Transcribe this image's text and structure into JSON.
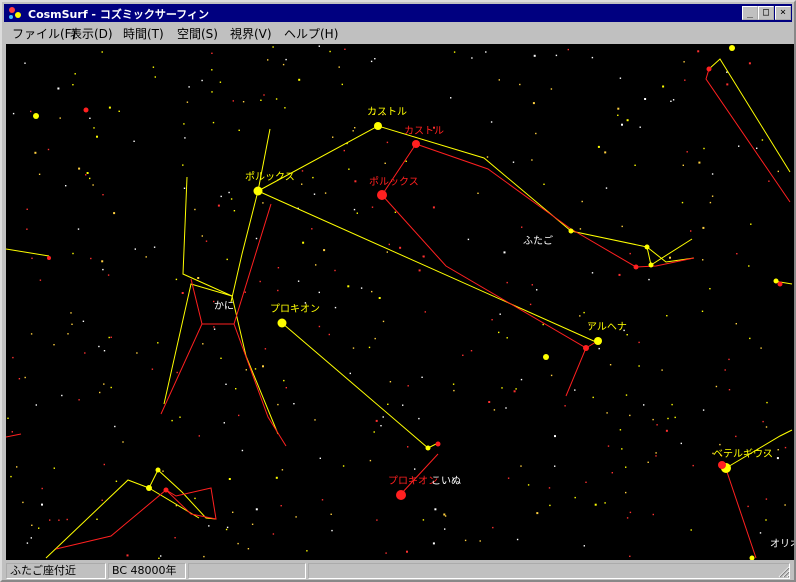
{
  "window": {
    "title": "CosmSurf - コズミックサーフィン",
    "min_label": "_",
    "max_label": "□",
    "close_label": "×"
  },
  "menu": [
    {
      "label": "ファイル(F)"
    },
    {
      "label": "表示(D)"
    },
    {
      "label": "時間(T)"
    },
    {
      "label": "空間(S)"
    },
    {
      "label": "視界(V)"
    },
    {
      "label": "ヘルプ(H)"
    }
  ],
  "sky": {
    "star_labels": {
      "castor_yellow": "カストル",
      "castor_red": "カストル",
      "pollux_yellow": "ポルックス",
      "pollux_red": "ポルックス",
      "procyon_yellow": "プロキオン",
      "procyon_red": "プロキオン",
      "alhena": "アルヘナ",
      "betelgeuse": "ベテルギウス"
    },
    "constellation_labels": {
      "gemini": "ふたご",
      "cancer": "かに",
      "canis_minor": "こいぬ",
      "orion": "オリオ"
    },
    "colors": {
      "background": "#000000",
      "yellow": "#ffff00",
      "red": "#ff2020",
      "label_white": "#ffffff"
    }
  },
  "status": {
    "region": "ふたご座付近",
    "epoch": "BC 48000年",
    "cell3": "",
    "cell4": ""
  }
}
